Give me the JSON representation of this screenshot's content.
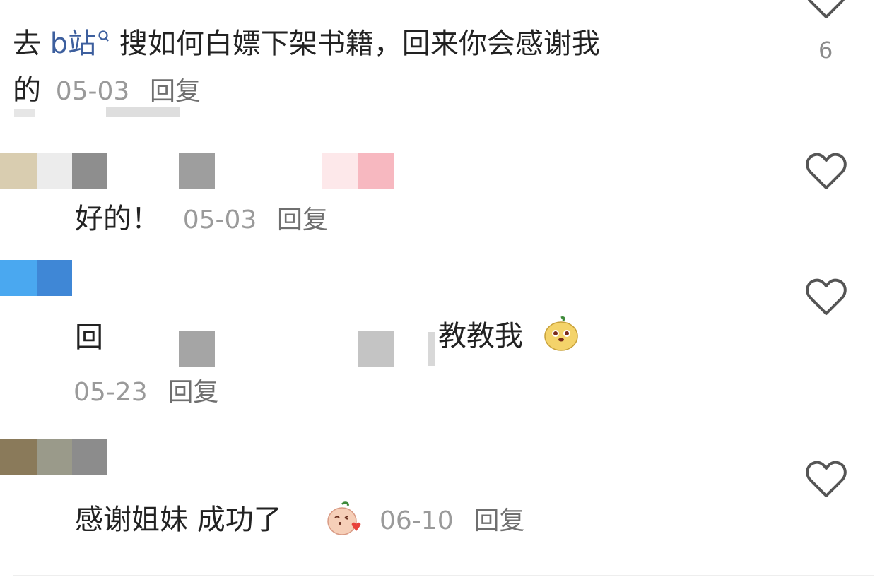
{
  "comments": [
    {
      "text_prefix": "去 ",
      "link_text": "b站",
      "text_main": " 搜如何白嫖下架书籍，回来你会感谢我",
      "text_line2": "的",
      "date": "05-03",
      "reply_label": "回复",
      "like_count": "6"
    },
    {
      "text": "好的！",
      "date": "05-03",
      "reply_label": "回复"
    },
    {
      "text_start": "回",
      "text_end": "教教我",
      "date": "05-23",
      "reply_label": "回复"
    },
    {
      "text": "感谢姐妹 成功了",
      "date": "06-10",
      "reply_label": "回复"
    }
  ],
  "icons": {
    "like": "heart-outline-icon",
    "search": "search-icon",
    "emoji_a": "yellow-mascot-emoji",
    "emoji_b": "kissing-peach-emoji"
  },
  "colors": {
    "link": "#3d5f9e",
    "text": "#222222",
    "meta": "#9a9a9a",
    "icon": "#555555"
  }
}
